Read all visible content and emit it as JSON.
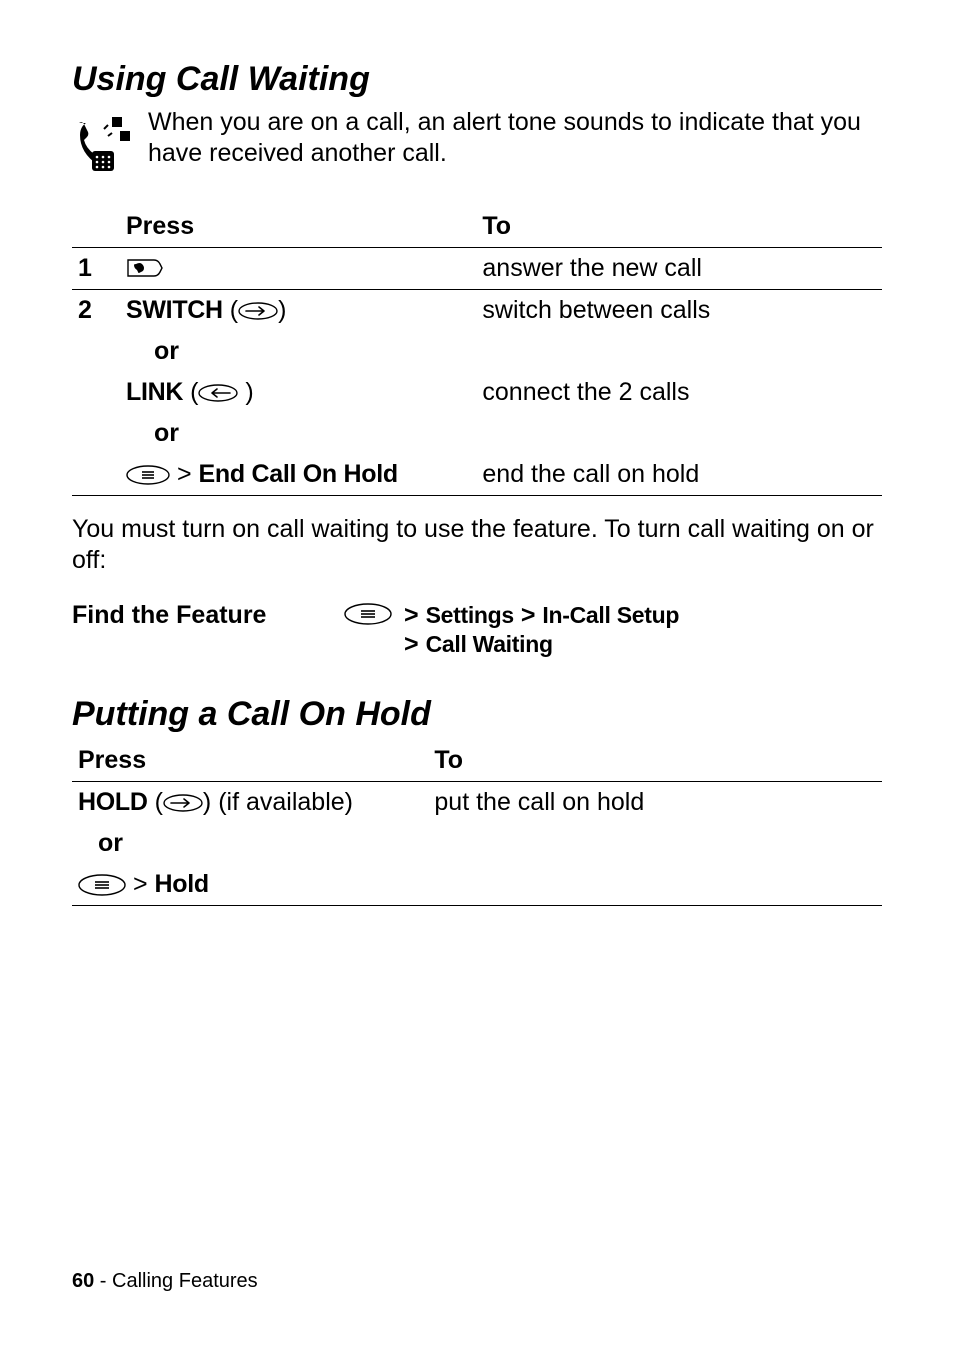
{
  "section1": {
    "title": "Using Call Waiting",
    "intro": "When you are on a call, an alert tone sounds to indicate that you have received another call.",
    "table": {
      "headers": {
        "press": "Press",
        "to": "To"
      },
      "row1": {
        "step": "1",
        "to": "answer the new call"
      },
      "row2": {
        "step": "2",
        "switch_label": "SWITCH",
        "switch_to": "switch between calls",
        "or1": "or",
        "link_label": "LINK",
        "link_to": "connect the 2 calls",
        "or2": "or",
        "end_label": "End Call On Hold",
        "end_to": "end the call on hold"
      }
    },
    "after": "You must turn on call waiting to use the feature. To turn call waiting on or off:",
    "feature": {
      "label": "Find the Feature",
      "gt": ">",
      "p1": "Settings",
      "p2": "In-Call Setup",
      "p3": "Call Waiting"
    }
  },
  "section2": {
    "title": "Putting a Call On Hold",
    "table": {
      "headers": {
        "press": "Press",
        "to": "To"
      },
      "hold_label": "HOLD",
      "hold_avail": " (if available)",
      "hold_to": "put the call on hold",
      "or": "or",
      "menu_hold": "Hold"
    }
  },
  "footer": {
    "page": "60",
    "sep": " - ",
    "chapter": "Calling Features"
  }
}
